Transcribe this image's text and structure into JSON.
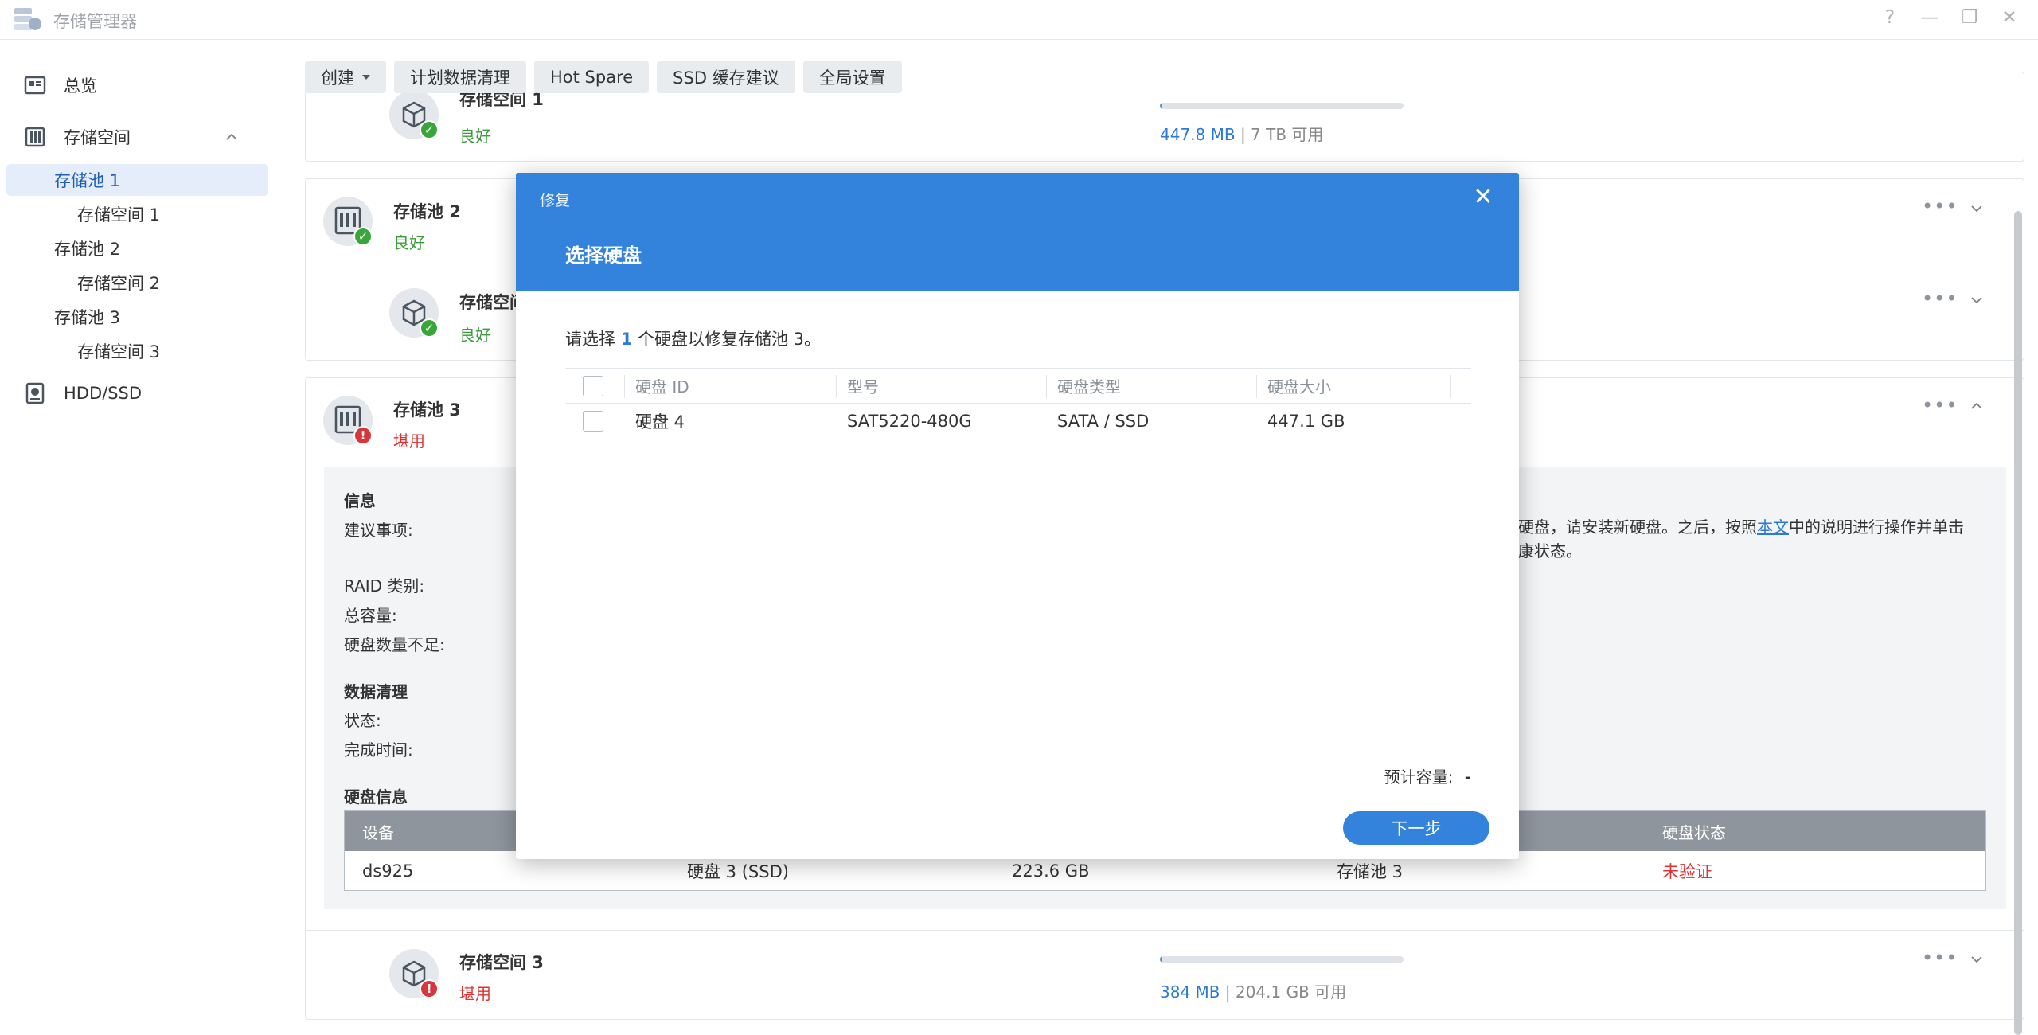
{
  "app": {
    "title": "存储管理器"
  },
  "window_buttons": [
    "?",
    "—",
    "❐",
    "✕"
  ],
  "sidebar": {
    "overview": "总览",
    "storage": "存储空间",
    "pools": [
      {
        "label": "存储池 1",
        "volume": "存储空间 1"
      },
      {
        "label": "存储池 2",
        "volume": "存储空间 2"
      },
      {
        "label": "存储池 3",
        "volume": "存储空间 3"
      }
    ],
    "hdd": "HDD/SSD"
  },
  "toolbar": {
    "create": "创建",
    "scrub": "计划数据清理",
    "hotspare": "Hot Spare",
    "ssd": "SSD 缓存建议",
    "global": "全局设置"
  },
  "cards": {
    "volume1": {
      "title": "存储空间 1",
      "status": "良好",
      "used": "447.8 MB",
      "avail": "7 TB 可用",
      "usage_percent": 1
    },
    "pool2": {
      "title": "存储池 2",
      "status": "良好"
    },
    "volume2": {
      "title": "存储空间",
      "status": "良好"
    },
    "pool3": {
      "title": "存储池 3",
      "status": "堪用"
    },
    "volume3": {
      "title": "存储空间 3",
      "status": "堪用",
      "used": "384 MB",
      "avail": "204.1 GB 可用",
      "usage_percent": 1
    }
  },
  "info": {
    "info_header": "信息",
    "advice_label": "建议事项:",
    "advice_text_1_pre": "硬盘，请安装新硬盘。之后，按照",
    "advice_link": "本文",
    "advice_text_1_post": "中的说明进行操作并单击",
    "advice_text_2": "康状态。",
    "raid_label": "RAID 类别:",
    "capacity_label": "总容量:",
    "insufficient_label": "硬盘数量不足:",
    "scrub_header": "数据清理",
    "state_label": "状态:",
    "done_label": "完成时间:",
    "disk_header": "硬盘信息"
  },
  "disk_table": {
    "headers": {
      "device": "设备",
      "status": "硬盘状态"
    },
    "row": {
      "device": "ds925",
      "disk": "硬盘 3 (SSD)",
      "size": "223.6 GB",
      "pool": "存储池 3",
      "status": "未验证"
    }
  },
  "modal": {
    "small_title": "修复",
    "title": "选择硬盘",
    "prompt_pre": "请选择",
    "prompt_num": "1",
    "prompt_post": "个硬盘以修复存储池 3。",
    "columns": [
      "硬盘 ID",
      "型号",
      "硬盘类型",
      "硬盘大小"
    ],
    "rows": [
      {
        "id": "硬盘 4",
        "model": "SAT5220-480G",
        "type": "SATA / SSD",
        "size": "447.1 GB"
      }
    ],
    "estimate_label": "预计容量:",
    "estimate_value": "-",
    "next": "下一步",
    "close_icon": "close-icon"
  },
  "colors": {
    "accent": "#3383dc",
    "good": "#3a9b3a",
    "bad": "#d33333"
  }
}
